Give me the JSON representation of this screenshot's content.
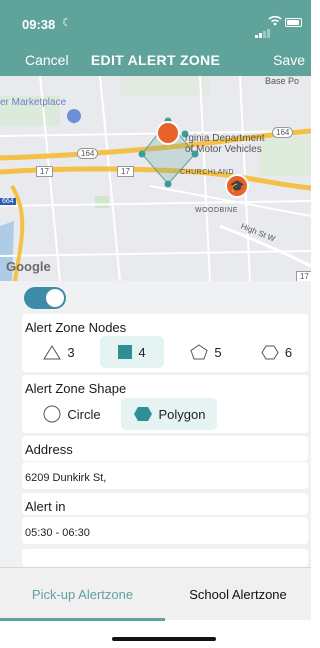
{
  "status_bar": {
    "time": "09:38"
  },
  "nav": {
    "cancel": "Cancel",
    "title": "EDIT ALERT ZONE",
    "save": "Save"
  },
  "map": {
    "labels": {
      "base": "Base Po",
      "marketplace": "er Marketplace",
      "dmv": "rginia Department\nof Motor Vehicles",
      "churchland": "CHURCHLAND",
      "woodbine": "WOODBINE",
      "high_st": "High St W",
      "r164a": "164",
      "r164b": "164",
      "r17a": "17",
      "r17b": "17",
      "r664": "664",
      "r17c": "17"
    },
    "google": "Google"
  },
  "form": {
    "toggle_on": true,
    "nodes": {
      "title": "Alert Zone Nodes",
      "options": [
        {
          "label": "3",
          "icon": "triangle-icon",
          "selected": false
        },
        {
          "label": "4",
          "icon": "square-icon",
          "selected": true
        },
        {
          "label": "5",
          "icon": "pentagon-icon",
          "selected": false
        },
        {
          "label": "6",
          "icon": "hexagon-icon",
          "selected": false
        }
      ]
    },
    "shape": {
      "title": "Alert Zone Shape",
      "options": [
        {
          "label": "Circle",
          "icon": "circle-icon",
          "selected": false
        },
        {
          "label": "Polygon",
          "icon": "hexagon-filled-icon",
          "selected": true
        }
      ]
    },
    "address": {
      "title": "Address",
      "value": "6209 Dunkirk St,"
    },
    "alert_in": {
      "title": "Alert in",
      "value": "05:30 - 06:30"
    }
  },
  "tabs": [
    {
      "label": "Pick-up Alertzone",
      "active": true
    },
    {
      "label": "School Alertzone",
      "active": false
    }
  ],
  "colors": {
    "teal": "#5fa39b",
    "toggle": "#3d8aa9",
    "selected_bg": "#e5f3f3",
    "marker": "#e8622c"
  }
}
